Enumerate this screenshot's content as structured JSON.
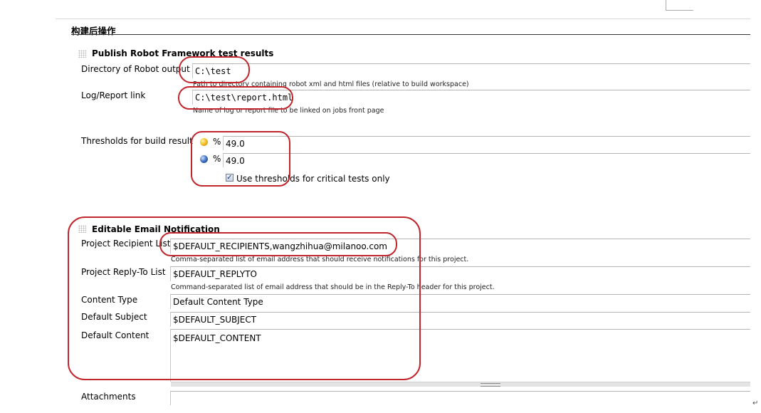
{
  "section": {
    "title": "构建后操作"
  },
  "robot": {
    "title": "Publish Robot Framework test results",
    "output_dir_label": "Directory of Robot output",
    "output_dir_value": "C:\\test",
    "output_dir_help": "Path to directory containing robot xml and html files (relative to build workspace)",
    "log_link_label": "Log/Report link",
    "log_link_value": "C:\\test\\report.html",
    "log_link_help": "Name of log or report file to be linked on jobs front page",
    "thresholds_label": "Thresholds for build result",
    "unstable_percent_sign": "%",
    "unstable_value": "49.0",
    "failed_percent_sign": "%",
    "failed_value": "49.0",
    "critical_only_label": "Use thresholds for critical tests only",
    "critical_only_checked": true
  },
  "email": {
    "title": "Editable Email Notification",
    "recipient_label": "Project Recipient List",
    "recipient_value": "$DEFAULT_RECIPIENTS,wangzhihua@milanoo.com",
    "recipient_help": "Comma-separated list of email address that should receive notifications for this project.",
    "replyto_label": "Project Reply-To List",
    "replyto_value": "$DEFAULT_REPLYTO",
    "replyto_help": "Command-separated list of email address that should be in the Reply-To header for this project.",
    "content_type_label": "Content Type",
    "content_type_value": "Default Content Type",
    "subject_label": "Default Subject",
    "subject_value": "$DEFAULT_SUBJECT",
    "content_label": "Default Content",
    "content_value": "$DEFAULT_CONTENT",
    "attachments_label": "Attachments",
    "attachments_value": ""
  },
  "misc": {
    "return_mark": "↵"
  },
  "colors": {
    "annotation": "#c0262c"
  }
}
